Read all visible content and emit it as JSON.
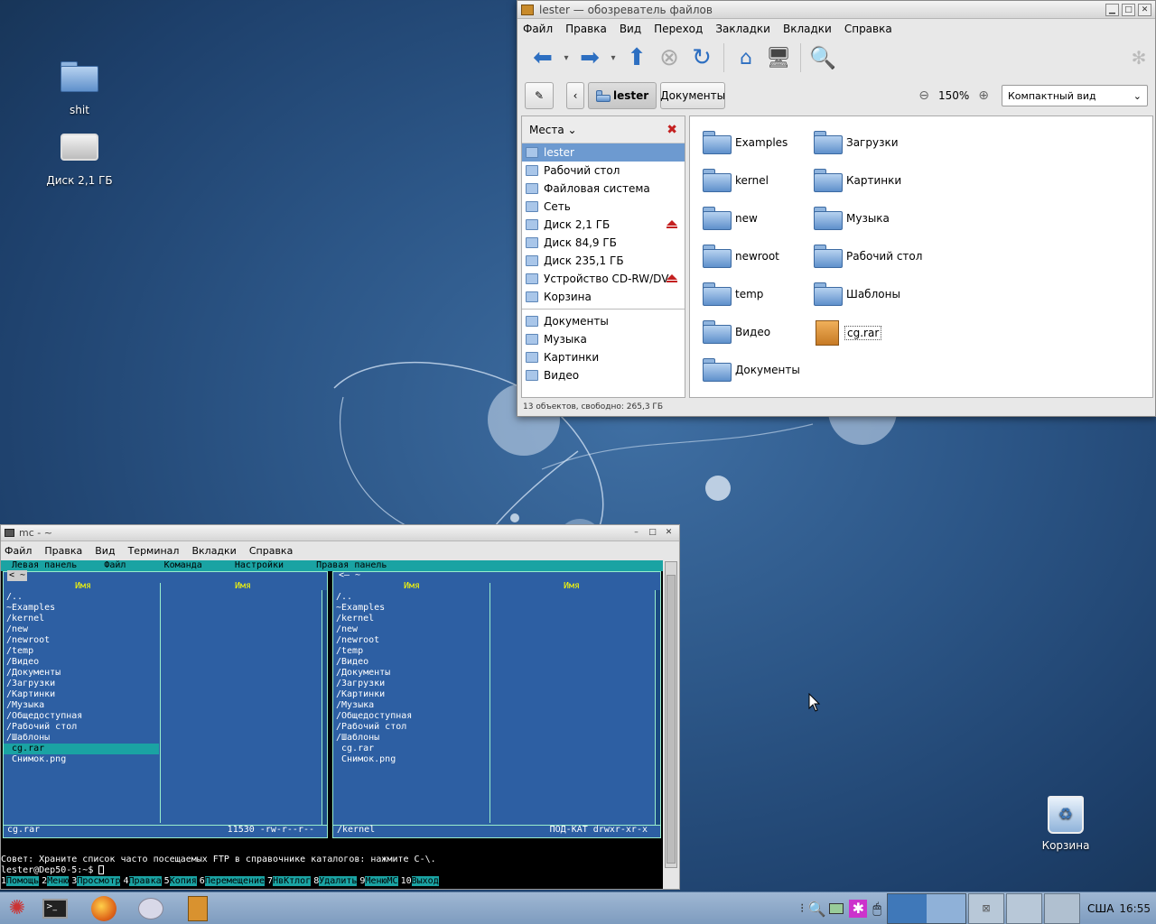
{
  "desktop": {
    "icons": [
      {
        "label": "shit",
        "icon": "folder-icon"
      },
      {
        "label": "Диск 2,1 ГБ",
        "icon": "hard-disk-icon"
      },
      {
        "label": "Корзина",
        "icon": "trash-icon"
      }
    ]
  },
  "fm": {
    "title": "lester — обозреватель файлов",
    "menu": [
      "Файл",
      "Правка",
      "Вид",
      "Переход",
      "Закладки",
      "Вкладки",
      "Справка"
    ],
    "breadcrumb": {
      "current": "lester",
      "next": "Документы"
    },
    "zoom": "150%",
    "view_mode": "Компактный вид",
    "places_header": "Места",
    "places": [
      {
        "label": "lester",
        "selected": true
      },
      {
        "label": "Рабочий стол"
      },
      {
        "label": "Файловая система"
      },
      {
        "label": "Сеть"
      },
      {
        "label": "Диск 2,1 ГБ",
        "eject": true
      },
      {
        "label": "Диск 84,9 ГБ"
      },
      {
        "label": "Диск 235,1 ГБ"
      },
      {
        "label": "Устройство CD-RW/DV...",
        "eject": true
      },
      {
        "label": "Корзина"
      }
    ],
    "bookmarks": [
      {
        "label": "Документы"
      },
      {
        "label": "Музыка"
      },
      {
        "label": "Картинки"
      },
      {
        "label": "Видео"
      }
    ],
    "files_col1": [
      "Examples",
      "kernel",
      "new",
      "newroot",
      "temp",
      "Видео",
      "Документы"
    ],
    "files_col2": [
      "Загрузки",
      "Картинки",
      "Музыка",
      "Рабочий стол",
      "Шаблоны",
      "cg.rar"
    ],
    "status": "13 объектов, свободно: 265,3 ГБ"
  },
  "term": {
    "title": "mc - ~",
    "menu": [
      "Файл",
      "Правка",
      "Вид",
      "Терминал",
      "Вкладки",
      "Справка"
    ],
    "mc_menu": " Левая панель     Файл       Команда      Настройки      Правая панель",
    "col_name": "Имя",
    "left_header": "< ~ ",
    "right_header": "<— ~ ",
    "left_rows": [
      "/..",
      "~Examples",
      "/kernel",
      "/new",
      "/newroot",
      "/temp",
      "/Видео",
      "/Документы",
      "/Загрузки",
      "/Картинки",
      "/Музыка",
      "/Общедоступная",
      "/Рабочий стол",
      "/Шаблоны",
      " cg.rar",
      " Снимок.png"
    ],
    "right_rows": [
      "/..",
      "~Examples",
      "/kernel",
      "/new",
      "/newroot",
      "/temp",
      "/Видео",
      "/Документы",
      "/Загрузки",
      "/Картинки",
      "/Музыка",
      "/Общедоступная",
      "/Рабочий стол",
      "/Шаблоны",
      " cg.rar",
      " Снимок.png"
    ],
    "left_footer_name": "cg.rar",
    "left_footer_info": "11530 -rw-r--r--",
    "right_footer_name": "/kernel",
    "right_footer_info": "ПОД-КАТ drwxr-xr-x",
    "tip": "Совет: Храните список часто посещаемых FTP в справочнике каталогов: нажмите C-\\.",
    "prompt": "lester@Dep50-5:~$ ",
    "fkeys": [
      {
        "n": "1",
        "l": "Помощь"
      },
      {
        "n": "2",
        "l": "Меню"
      },
      {
        "n": "3",
        "l": "Просмотр"
      },
      {
        "n": "4",
        "l": "Правка"
      },
      {
        "n": "5",
        "l": "Копия"
      },
      {
        "n": "6",
        "l": "Перемещение"
      },
      {
        "n": "7",
        "l": "НвКтлог"
      },
      {
        "n": "8",
        "l": "Удалить"
      },
      {
        "n": "9",
        "l": "МенюMC"
      },
      {
        "n": "10",
        "l": "Выход"
      }
    ]
  },
  "taskbar": {
    "layout": "США",
    "time": "16:55"
  },
  "colors": {
    "accent": "#6d9ad0",
    "mc_bg": "#2d5fa3",
    "mc_cyan": "#1aa3a3",
    "desktop": "#2c5687"
  }
}
